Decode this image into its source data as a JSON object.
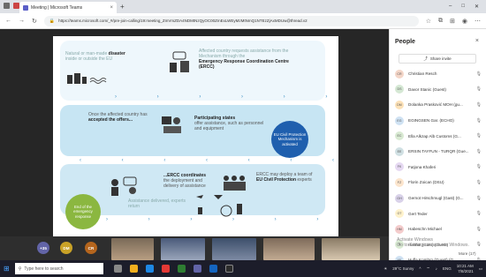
{
  "browser": {
    "tab_title": "Meeting | Microsoft Teams",
    "tab_close": "×",
    "new_tab": "+",
    "url": "https://teams.microsoft.com/_#/pre-join-calling/19:meeting_ZmVmZDA4NDMtNzQyOC00ZmExLWEyMzMtNmQ1NTEzZjAxMDUw@thread.v2",
    "win_min": "–",
    "win_max": "□",
    "win_close": "✕"
  },
  "slide": {
    "t1": "Natural or man-made",
    "t1b": "disaster",
    "t1c": "inside or outside the EU",
    "t2": "Affected country requests assistance from the Mechanism through the",
    "t2b": "Emergency Response Coordination Centre (ERCC)",
    "t3": "Once the affected country has",
    "t3b": "accepted the offers...",
    "t4b": "Participating states",
    "t4": "offer assistance, such as personnel and equipment",
    "blue_circle": "EU Civil Protection Mechanism is activated",
    "t5b": "...ERCC coordinates",
    "t5": "the deployment and delivery of assistance",
    "t6": "ERCC may deploy a team of",
    "t6b": "EU Civil Protection",
    "t6c": "experts",
    "t7": "Assistance delivered, experts return",
    "green_circle": "End of the emergency response"
  },
  "people": {
    "title": "People",
    "close": "×",
    "share": "Share invite",
    "participants": [
      {
        "initials": "CR",
        "name": "Christian Resch",
        "color": "#f4d6c8"
      },
      {
        "initials": "DS",
        "name": "Davor Stanic (Guest)",
        "color": "#d5e8d4"
      },
      {
        "initials": "DM",
        "name": "Dolanka Prasković MOH (gu...",
        "color": "#fde2b8"
      },
      {
        "initials": "EG",
        "name": "EGINGSEN Gar. (ECHO)",
        "color": "#cfe2f3"
      },
      {
        "initials": "EC",
        "name": "Ella Alkzap Alb Customs (G...",
        "color": "#d9ead3"
      },
      {
        "initials": "EE",
        "name": "ERSIN TAYFUN - TURQR (Gue...",
        "color": "#d0e0e3"
      },
      {
        "initials": "FK",
        "name": "Fatjona Khaferi",
        "color": "#e6d9f2"
      },
      {
        "initials": "FZ",
        "name": "Florin Zoican (DSU)",
        "color": "#fce5cd"
      },
      {
        "initials": "GH",
        "name": "Gernot Hirschmugl (Gast) (G...",
        "color": "#d9d2e9"
      },
      {
        "initials": "GT",
        "name": "Gert Teder",
        "color": "#fff2cc"
      },
      {
        "initials": "HM",
        "name": "Habeschn Michael",
        "color": "#f4cccc"
      },
      {
        "initials": "H",
        "name": "Helmut (Gast) (Guest)",
        "color": "#d9ead3"
      },
      {
        "initials": "HK",
        "name": "Hufla Kombro (Guest) (G...",
        "color": "#cfe2f3"
      }
    ],
    "more": "More (17)",
    "watermark1": "Activate Windows",
    "watermark2": "Go to Settings to activate Windows."
  },
  "strip": {
    "a1": "+35",
    "a2": "DM",
    "a3": "CR"
  },
  "taskbar": {
    "search": "Type here to search",
    "weather": "29°C Sunny",
    "lang": "ENG",
    "time": "10:21 AM",
    "date": "7/8/2021"
  }
}
